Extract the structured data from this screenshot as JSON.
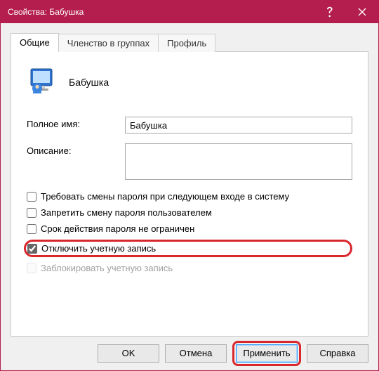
{
  "window": {
    "title": "Свойства: Бабушка"
  },
  "tabs": {
    "general": "Общие",
    "membership": "Членство в группах",
    "profile": "Профиль"
  },
  "user": {
    "display_name": "Бабушка"
  },
  "fields": {
    "full_name_label": "Полное имя:",
    "full_name_value": "Бабушка",
    "description_label": "Описание:",
    "description_value": ""
  },
  "checks": {
    "require_change": {
      "label": "Требовать смены пароля при следующем входе в систему",
      "checked": false,
      "disabled": false
    },
    "deny_change": {
      "label": "Запретить смену пароля пользователем",
      "checked": false,
      "disabled": false
    },
    "never_expire": {
      "label": "Срок действия пароля не ограничен",
      "checked": false,
      "disabled": false
    },
    "disable_acct": {
      "label": "Отключить учетную запись",
      "checked": true,
      "disabled": false
    },
    "lock_acct": {
      "label": "Заблокировать учетную запись",
      "checked": false,
      "disabled": true
    }
  },
  "buttons": {
    "ok": "OK",
    "cancel": "Отмена",
    "apply": "Применить",
    "help": "Справка"
  }
}
